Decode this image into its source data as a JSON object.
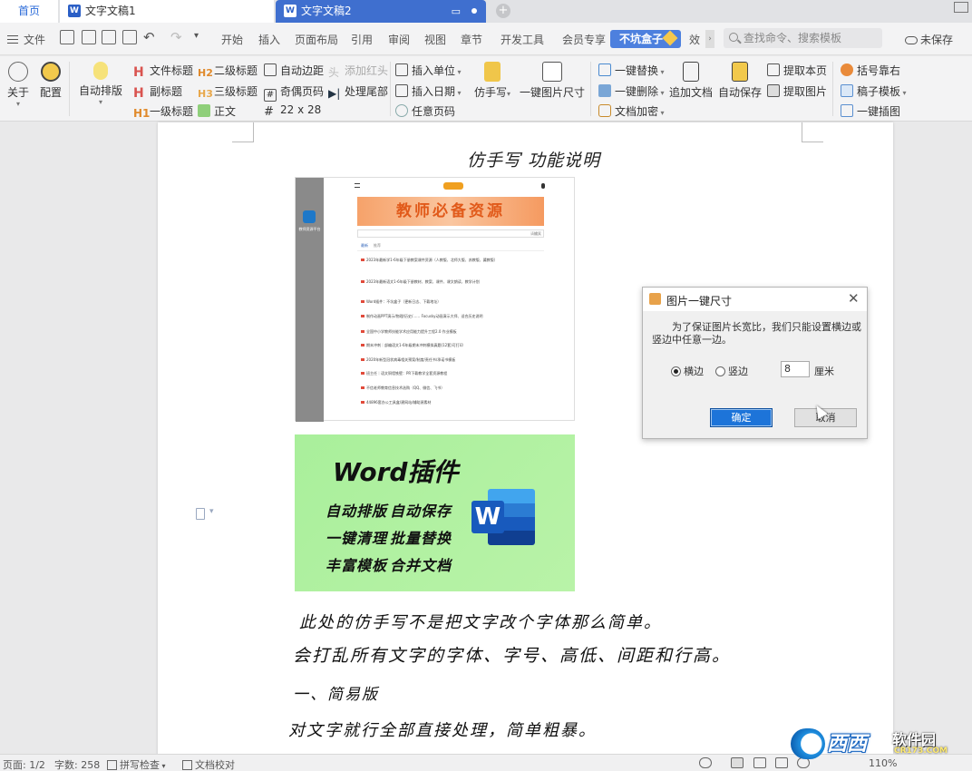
{
  "tabs": {
    "home": "首页",
    "doc1": "文字文稿1",
    "doc2": "文字文稿2"
  },
  "menu": {
    "file": "文件",
    "items": [
      "开始",
      "插入",
      "页面布局",
      "引用",
      "审阅",
      "视图",
      "章节",
      "开发工具",
      "会员专享"
    ],
    "highlight": "不坑盒子",
    "overflow": "效",
    "search_placeholder": "查找命令、搜索模板",
    "unsaved": "未保存"
  },
  "ribbon": {
    "about": "关于",
    "config": "配置",
    "auto_layout": "自动排版",
    "heading_doc": "文件标题",
    "heading2": "二级标题",
    "subtitle": "副标题",
    "heading3": "三级标题",
    "heading1": "一级标题",
    "body_text": "正文",
    "auto_margin": "自动边距",
    "add_redhead": "添加红头",
    "odd_even_page": "奇偶页码",
    "handle_tail": "处理尾部",
    "grid": "22 x 28",
    "insert_unit": "插入单位",
    "insert_date": "插入日期",
    "any_pagenum": "任意页码",
    "imitate_handwriting": "仿手写",
    "one_click_img_size": "一键图片尺寸",
    "one_click_replace": "一键替换",
    "one_click_delete": "一键删除",
    "doc_encrypt": "文档加密",
    "append_doc": "追加文档",
    "auto_save": "自动保存",
    "extract_page": "提取本页",
    "extract_image": "提取图片",
    "bracket_align": "括号靠右",
    "draft_template": "稿子模板",
    "one_click_chart": "一键插图"
  },
  "document": {
    "title": "仿手写 功能说明",
    "screenshot": {
      "banner": "教师必备资源",
      "search": "请输入",
      "search_btn": "搜索",
      "tab_active": "最新",
      "tab_other": "推荐",
      "items": [
        "2023年最新学1-6年级下册教案课件资源（人教版、北师大版、苏教版、冀教版）",
        "2023年最新语文1-6年级下册教材、教案、课件、课文朗读、教学计划",
        "Word插件：不坑盒子（更新日志、下载地址）",
        "制作动画PPT演示/物理/历史/…… Focusky动画演示大师、适合历史说明",
        "全国中小学教师技能学术应用能力提升工程2.0 作业模板",
        "期末冲刺｜部编语文1-6年级期末冲刺模拟真题(12套)可打印",
        "2020年新型冠状病毒相关预案/制度/责任书/承诺书模板",
        "班主任｜语文铜墙铁壁：PR下载教学全套资源教程",
        "不信老师教育信息技术选购（QQ、微信、飞书）",
        "44896套办公工具盒/建网站/辅助源素材"
      ],
      "logo_caption": "教师资源平台"
    },
    "promo": {
      "title": "Word插件",
      "lines": [
        "自动排版",
        "自动保存",
        "一键清理",
        "批量替换",
        "丰富模板",
        "合并文档"
      ]
    },
    "handwriting": [
      "此处的仿手写不是把文字改个字体那么简单。",
      "会打乱所有文字的字体、字号、高低、间距和行高。",
      "一、简易版",
      "对文字就行全部直接处理，简单粗暴。"
    ]
  },
  "dialog": {
    "title": "图片一键尺寸",
    "message": "为了保证图片长宽比，我们只能设置横边或竖边中任意一边。",
    "option_horizontal": "横边",
    "option_vertical": "竖边",
    "selected": "横边",
    "value": "8",
    "unit": "厘米",
    "ok": "确定",
    "cancel": "取消"
  },
  "status": {
    "page": "页面: 1/2",
    "words": "字数: 258",
    "spellcheck": "拼写检查",
    "proofread": "文档校对",
    "zoom": "110%"
  },
  "watermark": {
    "logo": "西西",
    "name": "软件园",
    "url": "CR173.COM"
  },
  "colors": {
    "accent": "#3f6fcf",
    "highlight_menu": "#4d80de",
    "promo_bg": "#a9ef9b",
    "banner_text": "#e15a1a"
  }
}
